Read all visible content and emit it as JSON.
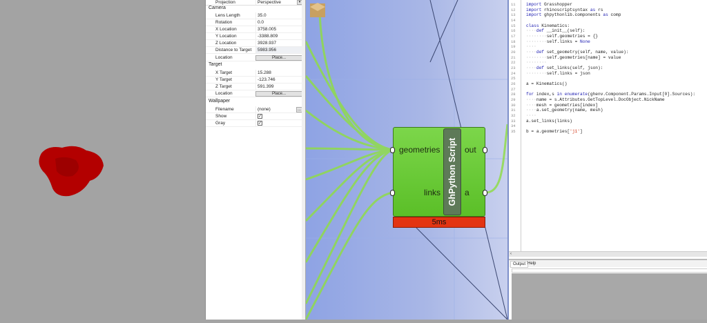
{
  "properties": {
    "projection": {
      "label": "Projection",
      "value": "Perspective"
    },
    "camera": {
      "header": "Camera",
      "rows": [
        {
          "label": "Lens Length",
          "value": "35.0"
        },
        {
          "label": "Rotation",
          "value": "0.0"
        },
        {
          "label": "X Location",
          "value": "3758.005"
        },
        {
          "label": "Y Location",
          "value": "-3388.809"
        },
        {
          "label": "Z Location",
          "value": "3928.937"
        },
        {
          "label": "Distance to Target",
          "value": "5983.956"
        }
      ],
      "location_label": "Location",
      "place_button": "Place..."
    },
    "target": {
      "header": "Target",
      "rows": [
        {
          "label": "X Target",
          "value": "15.288"
        },
        {
          "label": "Y Target",
          "value": "-123.746"
        },
        {
          "label": "Z Target",
          "value": "591.399"
        }
      ],
      "location_label": "Location",
      "place_button": "Place..."
    },
    "wallpaper": {
      "header": "Wallpaper",
      "filename_label": "Filename",
      "filename_value": "(none)",
      "browse_button": "...",
      "show_label": "Show",
      "show_checked": true,
      "gray_label": "Gray",
      "gray_checked": true,
      "check_glyph": "✓"
    }
  },
  "component": {
    "inputs": [
      "geometries",
      "links"
    ],
    "outputs": [
      "out",
      "a"
    ],
    "nickname": "GhPython Script",
    "timer": "5ms"
  },
  "editor": {
    "lines": [
      {
        "n": "11",
        "t": "import Grasshopper"
      },
      {
        "n": "12",
        "t": "import rhinoscriptsyntax as rs"
      },
      {
        "n": "13",
        "t": "import ghpythonlib.components as comp"
      },
      {
        "n": "14",
        "t": ""
      },
      {
        "n": "15",
        "t": "class Kinematics:"
      },
      {
        "n": "16",
        "t": "····def __init__(self):"
      },
      {
        "n": "17",
        "t": "········self.geometries = {}"
      },
      {
        "n": "18",
        "t": "········self.links = None"
      },
      {
        "n": "19",
        "t": "····"
      },
      {
        "n": "20",
        "t": "····def set_geometry(self, name, value):"
      },
      {
        "n": "21",
        "t": "········self.geometries[name] = value"
      },
      {
        "n": "22",
        "t": "········"
      },
      {
        "n": "23",
        "t": "····def set_links(self, json):"
      },
      {
        "n": "24",
        "t": "········self.links = json"
      },
      {
        "n": "25",
        "t": ""
      },
      {
        "n": "26",
        "t": "a = Kinematics()"
      },
      {
        "n": "27",
        "t": ""
      },
      {
        "n": "28",
        "t": "for index,s in enumerate(ghenv.Component.Params.Input[0].Sources):"
      },
      {
        "n": "29",
        "t": "····name = s.Attributes.GetTopLevel.DocObject.NickName"
      },
      {
        "n": "30",
        "t": "····mesh = geometries[index]"
      },
      {
        "n": "31",
        "t": "····a.set_geometry(name, mesh)"
      },
      {
        "n": "32",
        "t": "····"
      },
      {
        "n": "33",
        "t": "a.set_links(links)"
      },
      {
        "n": "34",
        "t": ""
      },
      {
        "n": "35",
        "t": "b = a.geometries['j1']"
      }
    ],
    "scroll_left": "‹",
    "tabs": [
      "Output",
      "Help"
    ]
  },
  "colors": {
    "model": "#b30000",
    "wire": "#8fdc4a",
    "component": "#6ccb38",
    "timer": "#e33412"
  }
}
